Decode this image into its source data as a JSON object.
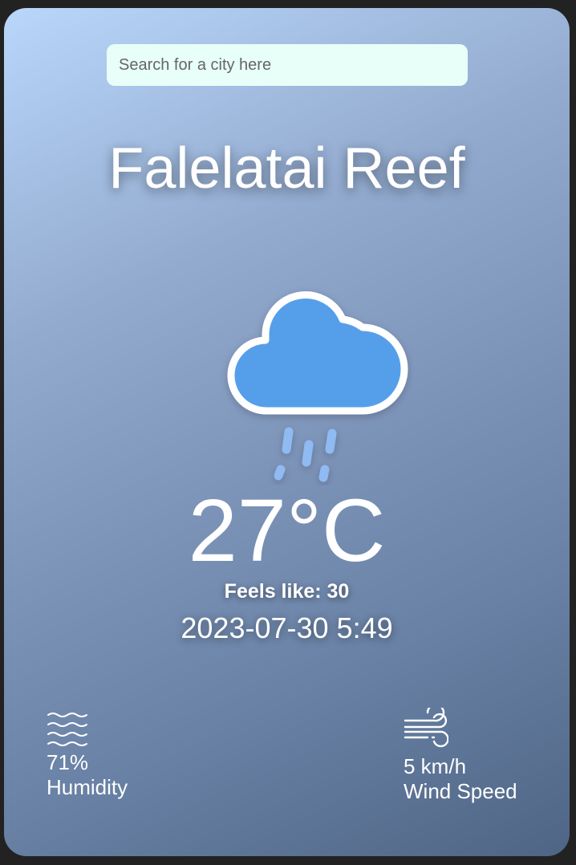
{
  "search": {
    "placeholder": "Search for a city here"
  },
  "location": {
    "city": "Falelatai Reef"
  },
  "current": {
    "icon": "rain-cloud-icon",
    "temperature": "27°C",
    "feels_like": "Feels like: 30",
    "datetime": "2023-07-30 5:49"
  },
  "details": {
    "humidity": {
      "icon": "waves-icon",
      "value": "71%",
      "label": "Humidity"
    },
    "wind": {
      "icon": "wind-icon",
      "value": "5 km/h",
      "label": "Wind Speed"
    }
  },
  "colors": {
    "cloud_fill": "#559fea",
    "rain_drop": "#8fbaf2",
    "search_bg": "#e8fef8"
  }
}
